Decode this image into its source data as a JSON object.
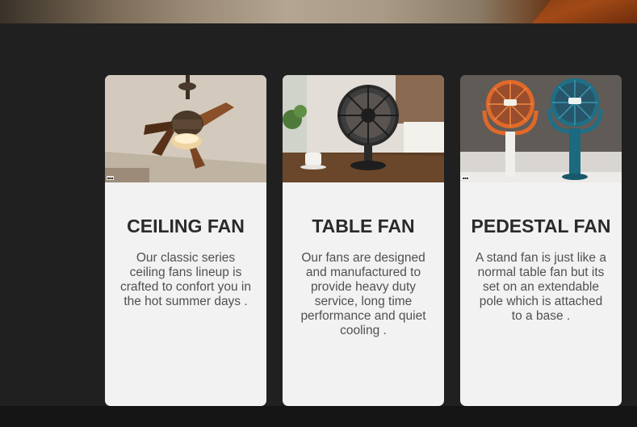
{
  "products": [
    {
      "title": "CEILING FAN",
      "description": "Our classic series ceiling fans lineup is crafted to confort you in the hot summer days .",
      "image_icon": "ceiling-fan-photo"
    },
    {
      "title": "TABLE FAN",
      "description": "Our fans are designed and manufactured to provide heavy duty service, long time performance and quiet cooling .",
      "image_icon": "table-fan-photo"
    },
    {
      "title": "PEDESTAL FAN",
      "description": "A stand fan is just like a normal table fan but its set on an extendable pole which is attached to a base .",
      "image_icon": "pedestal-fan-photo"
    }
  ],
  "colors": {
    "page_background": "#202020",
    "card_background": "#f2f2f2",
    "title_color": "#2a2a2a",
    "text_color": "#505050"
  }
}
